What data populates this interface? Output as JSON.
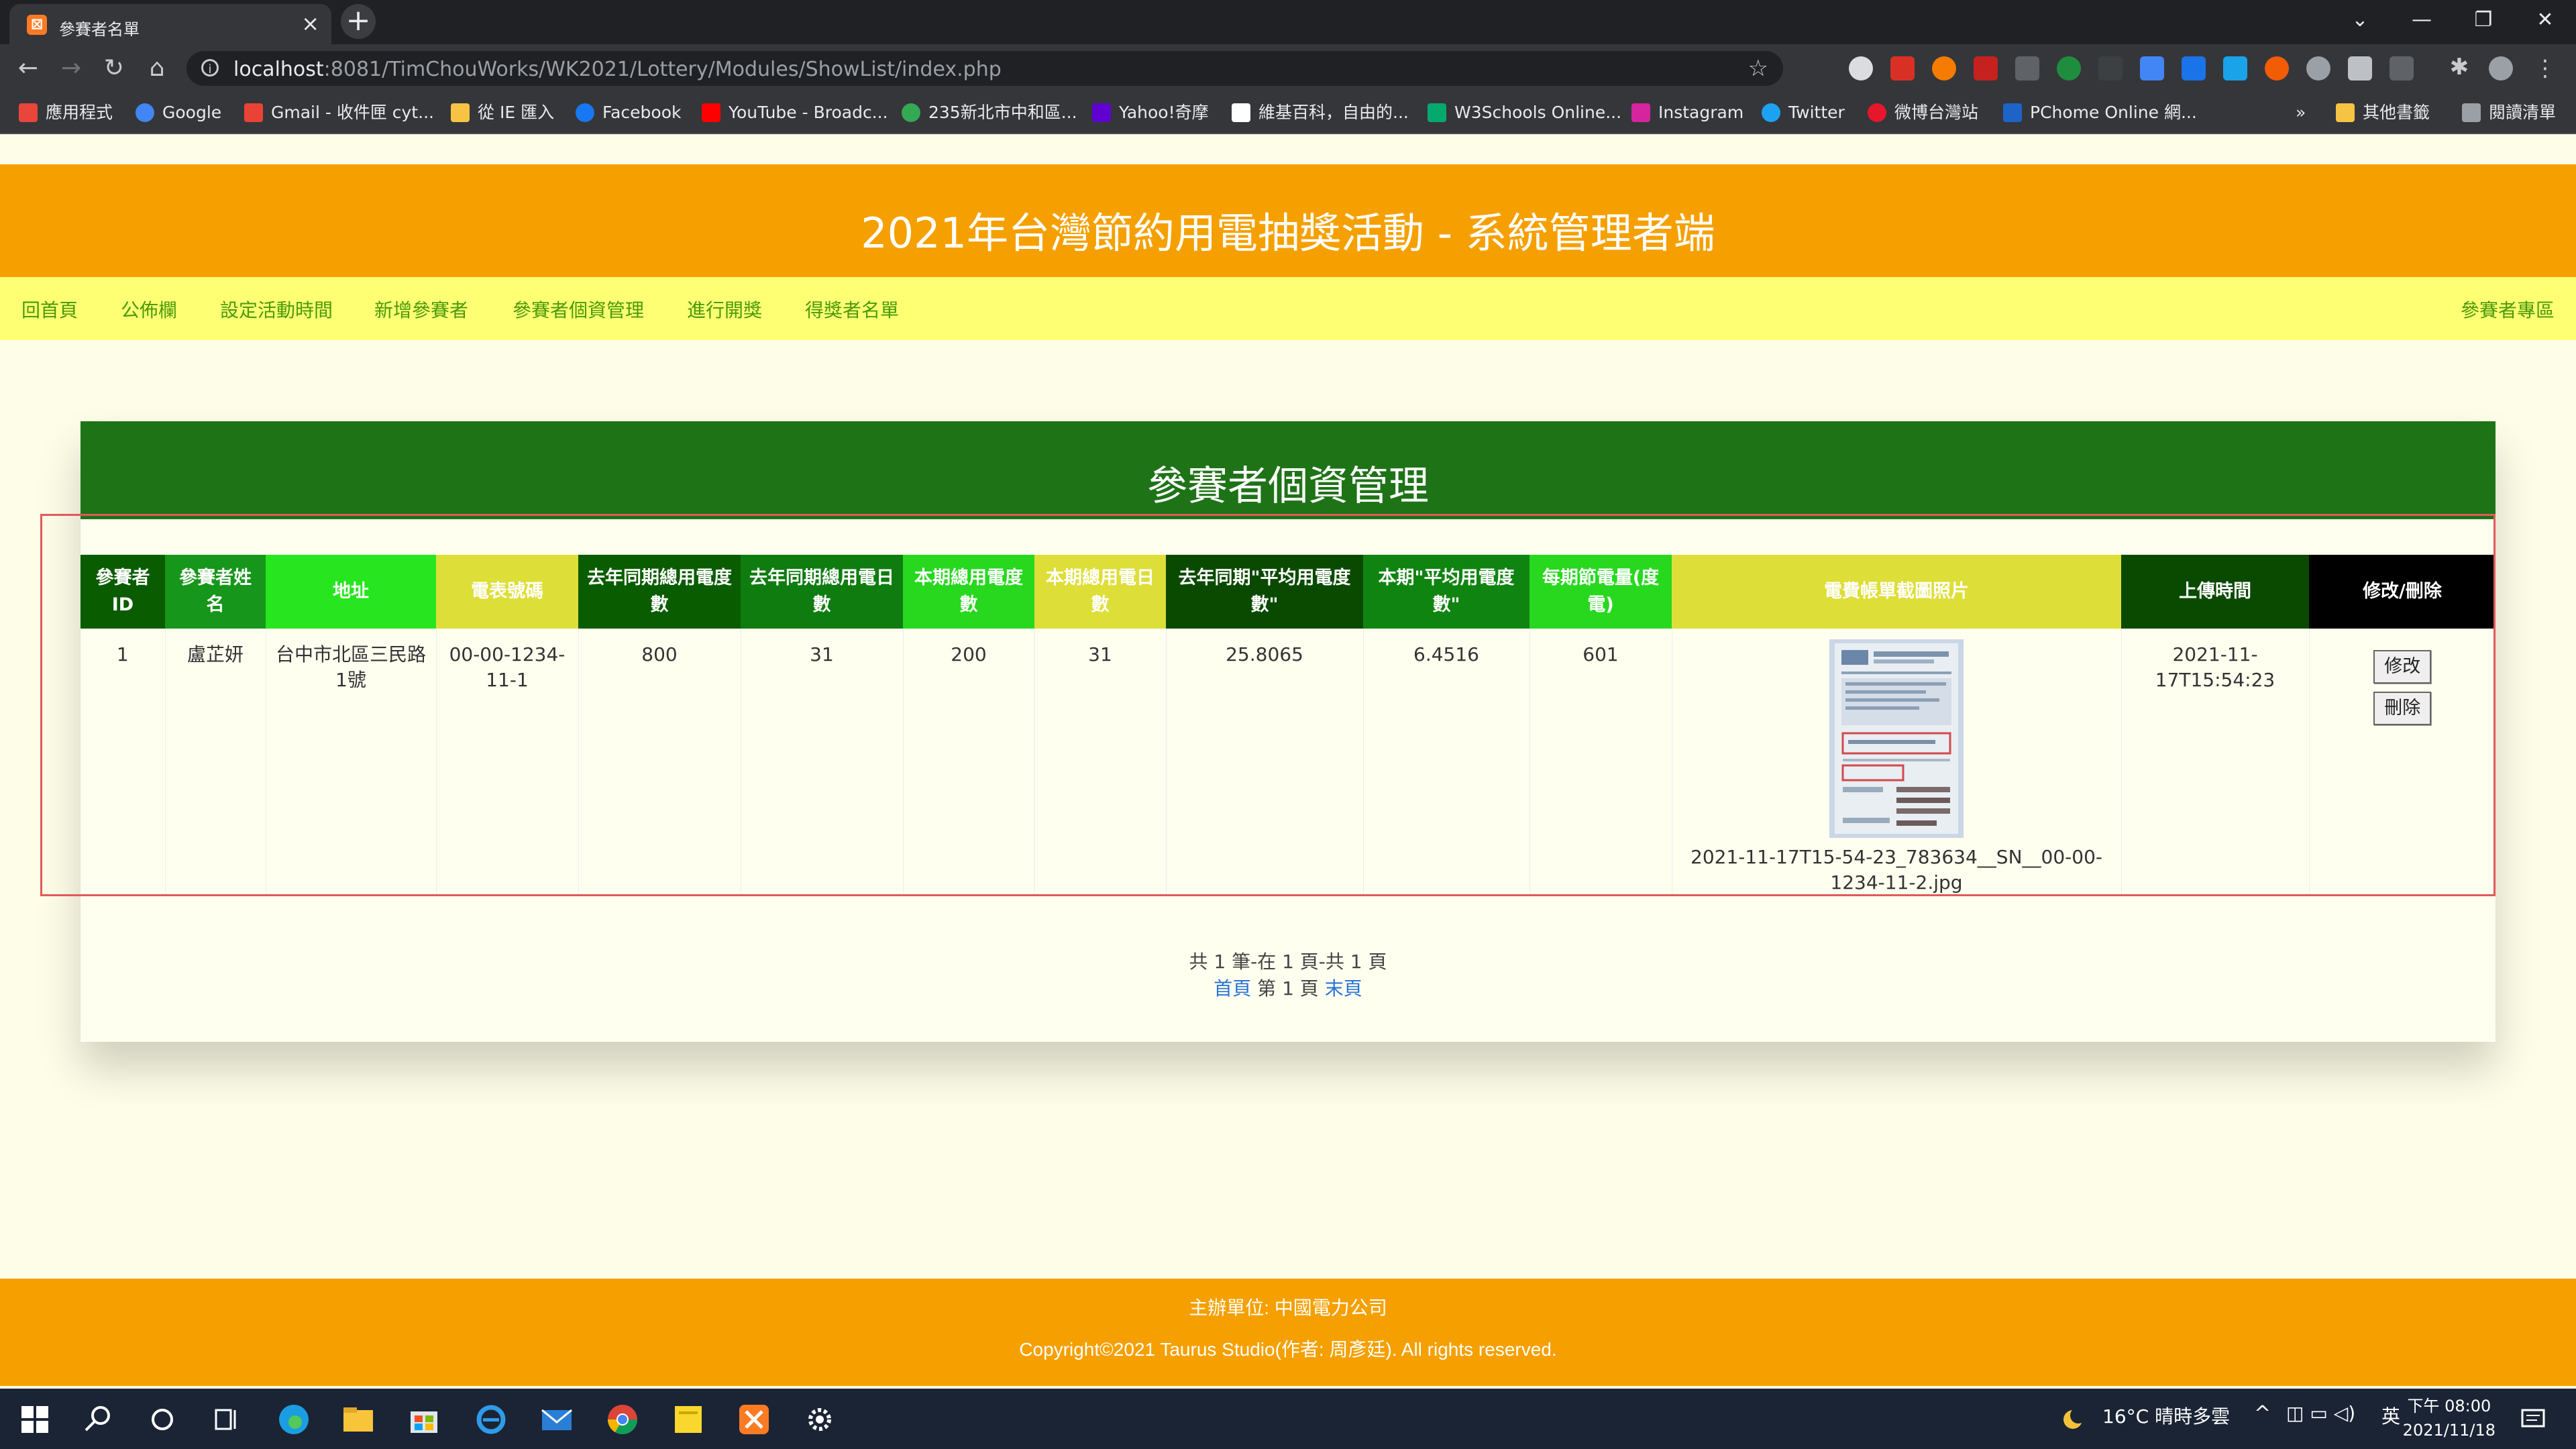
{
  "browser": {
    "tab_title": "參賽者名單",
    "tab_close": "×",
    "new_tab": "+",
    "url_host": "localhost",
    "url_rest": ":8081/TimChouWorks/WK2021/Lottery/Modules/ShowList/index.php",
    "window_controls": [
      "⌄",
      "—",
      "❐",
      "✕"
    ]
  },
  "bookmarks": [
    {
      "label": "應用程式",
      "color": "#e8453c"
    },
    {
      "label": "Google",
      "color": "#4285f4"
    },
    {
      "label": "Gmail - 收件匣 cyt...",
      "color": "#ea4335"
    },
    {
      "label": "從 IE 匯入",
      "color": "#f6c343"
    },
    {
      "label": "Facebook",
      "color": "#1877f2"
    },
    {
      "label": "YouTube - Broadc...",
      "color": "#ff0000"
    },
    {
      "label": "235新北市中和區...",
      "color": "#34a853"
    },
    {
      "label": "Yahoo!奇摩",
      "color": "#6001d2"
    },
    {
      "label": "維基百科，自由的...",
      "color": "#ffffff"
    },
    {
      "label": "W3Schools Online...",
      "color": "#04aa6d"
    },
    {
      "label": "Instagram",
      "color": "#d6249f"
    },
    {
      "label": "Twitter",
      "color": "#1da1f2"
    },
    {
      "label": "微博台灣站",
      "color": "#e6162d"
    },
    {
      "label": "PChome Online 網...",
      "color": "#1e64c8"
    },
    {
      "label": "»",
      "color": ""
    },
    {
      "label": "其他書籤",
      "color": "#f6c343"
    },
    {
      "label": "閱讀清單",
      "color": "#9aa0a6"
    }
  ],
  "site": {
    "title": "2021年台灣節約用電抽獎活動 - 系統管理者端",
    "nav": [
      "回首頁",
      "公佈欄",
      "設定活動時間",
      "新增參賽者",
      "參賽者個資管理",
      "進行開獎",
      "得獎者名單"
    ],
    "nav_right": "參賽者專區"
  },
  "panel": {
    "title": "參賽者個資管理",
    "columns": [
      {
        "label": "參賽者ID",
        "bg": "#0a5c00"
      },
      {
        "label": "參賽者姓名",
        "bg": "#16961a"
      },
      {
        "label": "地址",
        "bg": "#27e61f"
      },
      {
        "label": "電表號碼",
        "bg": "#dede38"
      },
      {
        "label": "去年同期總用電度數",
        "bg": "#0a5c00"
      },
      {
        "label": "去年同期總用電日數",
        "bg": "#0f7c10"
      },
      {
        "label": "本期總用電度數",
        "bg": "#27d81f"
      },
      {
        "label": "本期總用電日數",
        "bg": "#dede38"
      },
      {
        "label": "去年同期\"平均用電度數\"",
        "bg": "#0a4a00"
      },
      {
        "label": "本期\"平均用電度數\"",
        "bg": "#0f8410"
      },
      {
        "label": "每期節電量(度電)",
        "bg": "#27d81f"
      },
      {
        "label": "電費帳單截圖照片",
        "bg": "#dede38"
      },
      {
        "label": "上傳時間",
        "bg": "#0a4a00"
      },
      {
        "label": "修改/刪除",
        "bg": "#000000"
      }
    ],
    "rows": [
      {
        "id": "1",
        "name": "盧芷妍",
        "address": "台中市北區三民路1號",
        "meter": "00-00-1234-11-1",
        "last_kwh": "800",
        "last_days": "31",
        "this_kwh": "200",
        "this_days": "31",
        "last_avg": "25.8065",
        "this_avg": "6.4516",
        "saved": "601",
        "photo_name": "2021-11-17T15-54-23_783634__SN__00-00-1234-11-2.jpg",
        "upload_time": "2021-11-17T15:54:23",
        "edit_label": "修改",
        "delete_label": "刪除"
      }
    ],
    "pager_summary": "共 1 筆-在 1 頁-共 1 頁",
    "pager_first": "首頁",
    "pager_current": " 第 1 頁 ",
    "pager_last": "末頁"
  },
  "footer": {
    "org": "主辦單位: 中國電力公司",
    "copyright": "Copyright©2021 Taurus Studio(作者: 周彥廷). All rights reserved."
  },
  "taskbar": {
    "weather": "16°C  晴時多雲",
    "ime": "英",
    "clock_time": "下午 08:00",
    "clock_date": "2021/11/18"
  }
}
